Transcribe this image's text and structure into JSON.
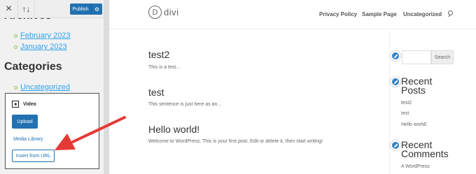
{
  "customizer": {
    "publish_label": "Publish",
    "close_icon": "close-icon",
    "sort_icon": "sort-arrows-icon",
    "settings_icon": "gear-icon"
  },
  "sidebar_preview": {
    "archives_heading": "Archives",
    "archive_links": [
      "February 2023",
      "January 2023"
    ],
    "categories_heading": "Categories",
    "category_links": [
      "Uncategorized"
    ]
  },
  "media_panel": {
    "title": "Video",
    "upload_label": "Upload",
    "media_library_label": "Media Library",
    "insert_url_label": "Insert from URL"
  },
  "site": {
    "logo_letter": "D",
    "logo_text": "divi",
    "nav": [
      "Privacy Policy",
      "Sample Page",
      "Uncategorized"
    ],
    "posts": [
      {
        "title": "test2",
        "excerpt": "This is a test..."
      },
      {
        "title": "test",
        "excerpt": "This sentence is just here as an..."
      },
      {
        "title": "Hello world!",
        "excerpt": "Welcome to WordPress. This is your first post. Edit or delete it, then start writing!"
      }
    ],
    "search_button_label": "Search",
    "recent_posts_heading": "Recent Posts",
    "recent_posts": [
      "test2",
      "test",
      "Hello world!"
    ],
    "recent_comments_heading": "Recent Comments",
    "recent_comments": [
      "A WordPress"
    ]
  },
  "colors": {
    "accent": "#2271b1",
    "link": "#2ea3f2",
    "annotation_arrow": "#e53935"
  }
}
